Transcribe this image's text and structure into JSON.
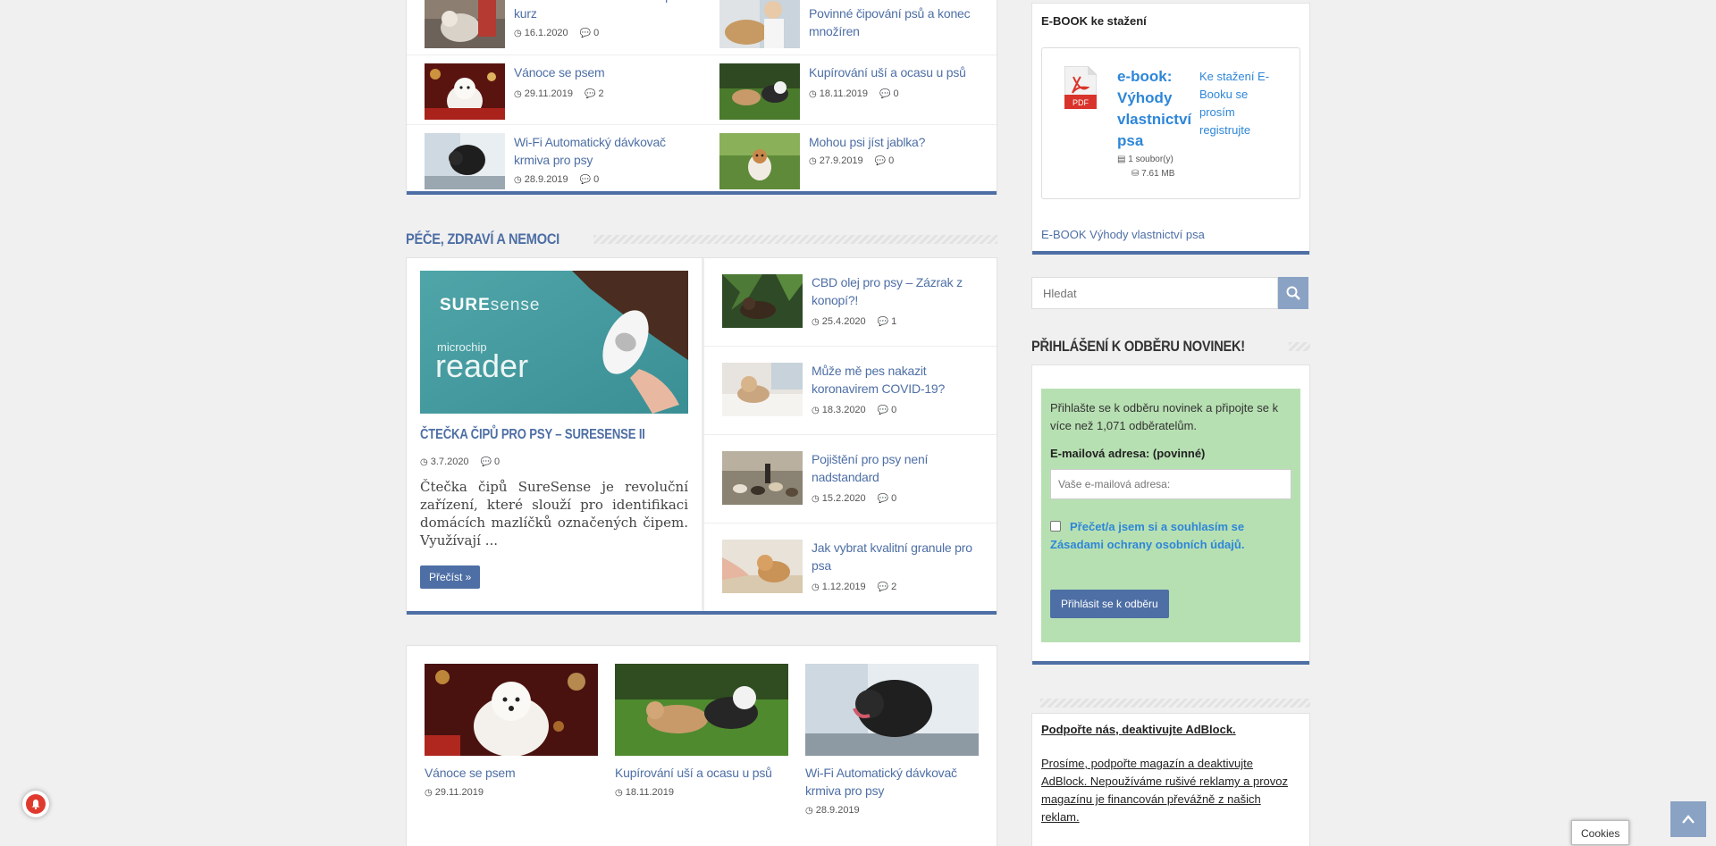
{
  "top_box": {
    "posts": [
      {
        "title": "Tisíc Vídeňanů absolvovalo psí kurz",
        "date": "16.1.2020",
        "comments": "0",
        "image": "dog-with-person"
      },
      {
        "title": "Novela veterinárního zákona: Povinné čipování psů a konec množíren",
        "date": "",
        "comments": "",
        "image": "vet-with-dog"
      },
      {
        "title": "Vánoce se psem",
        "date": "29.11.2019",
        "comments": "2",
        "image": "westie-christmas"
      },
      {
        "title": "Kupírování uší a ocasu u psů",
        "date": "18.11.2019",
        "comments": "0",
        "image": "dogs-playing-grass"
      },
      {
        "title": "Wi-Fi Automatický dávkovač krmiva pro psy",
        "date": "28.9.2019",
        "comments": "0",
        "image": "dog-car-window"
      },
      {
        "title": "Mohou psi jíst jablka?",
        "date": "27.9.2019",
        "comments": "0",
        "image": "terrier-grass"
      }
    ]
  },
  "care_section": {
    "heading": "Péče, zdraví a nemoci",
    "featured": {
      "image_text_brand": "SURE",
      "image_text_brand2": "sense",
      "image_text_small": "microchip",
      "image_text_big": "reader",
      "title": "Čtečka čipů pro psy – SureSense II",
      "date": "3.7.2020",
      "comments": "0",
      "excerpt": "Čtečka čipů SureSense je revoluční zařízení, které slouží pro identifikaci domácích mazlíčků označených čipem. Využívají ...",
      "read_more": "Přečíst »"
    },
    "list": [
      {
        "title": "CBD olej pro psy – Zázrak z konopí?!",
        "date": "25.4.2020",
        "comments": "1",
        "image": "dog-cannabis"
      },
      {
        "title": "Může mě pes nakazit koronavirem COVID-19?",
        "date": "18.3.2020",
        "comments": "0",
        "image": "dog-on-bed"
      },
      {
        "title": "Pojištění pro psy není nadstandard",
        "date": "15.2.2020",
        "comments": "0",
        "image": "dog-pack-walk"
      },
      {
        "title": "Jak vybrat kvalitní granule pro psa",
        "date": "1.12.2019",
        "comments": "2",
        "image": "dog-eating"
      }
    ]
  },
  "gallery": [
    {
      "title": "Vánoce se psem",
      "date": "29.11.2019",
      "image": "westie-christmas"
    },
    {
      "title": "Kupírování uší a ocasu u psů",
      "date": "18.11.2019",
      "image": "dogs-playing-grass"
    },
    {
      "title": "Wi-Fi Automatický dávkovač krmiva pro psy",
      "date": "28.9.2019",
      "image": "dog-car-window"
    }
  ],
  "sidebar": {
    "ebook": {
      "heading": "E-BOOK ke stažení",
      "icon_label": "PDF",
      "title": "e-book: Výhody vlastnictví psa",
      "download_text": "Ke stažení E-Booku se prosím registrujte",
      "files": "1 soubor(y)",
      "size": "7.61 MB",
      "footer_link": "E-BOOK Výhody vlastnictví psa"
    },
    "search": {
      "placeholder": "Hledat"
    },
    "newsletter": {
      "heading": "Přihlášení k odběru novinek!",
      "intro": "Přihlašte se k odběru novinek a připojte se k více než 1,071 odběratelům.",
      "email_label": "E-mailová adresa: (povinné)",
      "email_placeholder": "Vaše e-mailová adresa:",
      "consent": "Přečet/a jsem si a souhlasím se Zásadami ochrany osobních údajů.",
      "submit": "Přihlásit se k odběru"
    },
    "adblock": {
      "title": "Podpořte nás, deaktivujte AdBlock.",
      "text": "Prosíme, podpořte magazín a deaktivujte AdBlock. Nepoužíváme rušivé reklamy a provoz magazínu je financován převážně z našich reklam."
    }
  },
  "floating": {
    "cookies": "Cookies"
  },
  "colors": {
    "accent": "#4e6fa5",
    "green_box": "#b7e0b2",
    "link_blue": "#2e86d8"
  }
}
